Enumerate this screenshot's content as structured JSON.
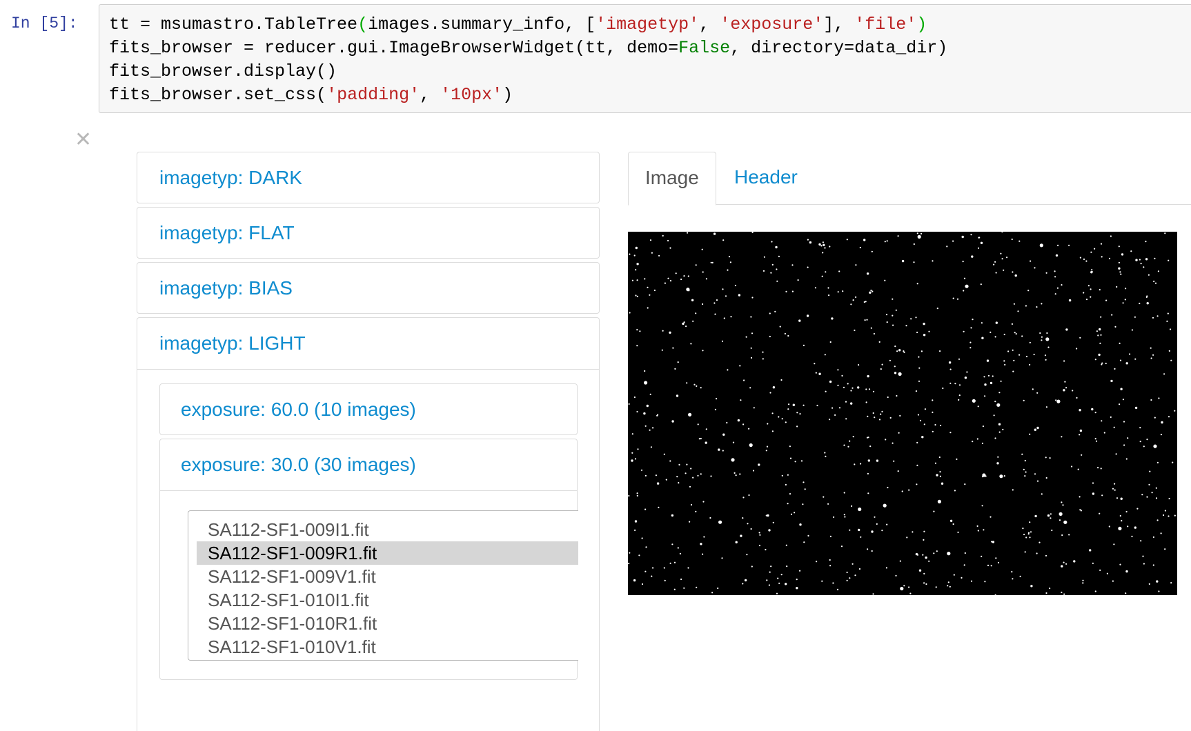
{
  "cell": {
    "prompt": "In [5]:",
    "code_lines": [
      "tt = msumastro.TableTree(images.summary_info, ['imagetyp', 'exposure'], 'file')",
      "fits_browser = reducer.gui.ImageBrowserWidget(tt, demo=False, directory=data_dir)",
      "fits_browser.display()",
      "fits_browser.set_css('padding', '10px')"
    ]
  },
  "widget": {
    "close_glyph": "✕",
    "accordion": [
      {
        "label": "imagetyp: DARK"
      },
      {
        "label": "imagetyp: FLAT"
      },
      {
        "label": "imagetyp: BIAS"
      },
      {
        "label": "imagetyp: LIGHT"
      }
    ],
    "sub_accordion": [
      {
        "label": "exposure: 60.0 (10 images)"
      },
      {
        "label": "exposure: 30.0 (30 images)"
      }
    ],
    "files": [
      "SA112-SF1-009I1.fit",
      "SA112-SF1-009R1.fit",
      "SA112-SF1-009V1.fit",
      "SA112-SF1-010I1.fit",
      "SA112-SF1-010R1.fit",
      "SA112-SF1-010V1.fit"
    ],
    "selected_file": "SA112-SF1-009R1.fit",
    "tabs": [
      {
        "label": "Image",
        "active": true
      },
      {
        "label": "Header",
        "active": false
      }
    ],
    "image_description_icon": "star-field-image"
  },
  "colors": {
    "link": "#0f8ccf",
    "prompt": "#303f9f",
    "string": "#ba2121",
    "keyword": "#008000",
    "selected_bg": "#d6d6d6"
  }
}
